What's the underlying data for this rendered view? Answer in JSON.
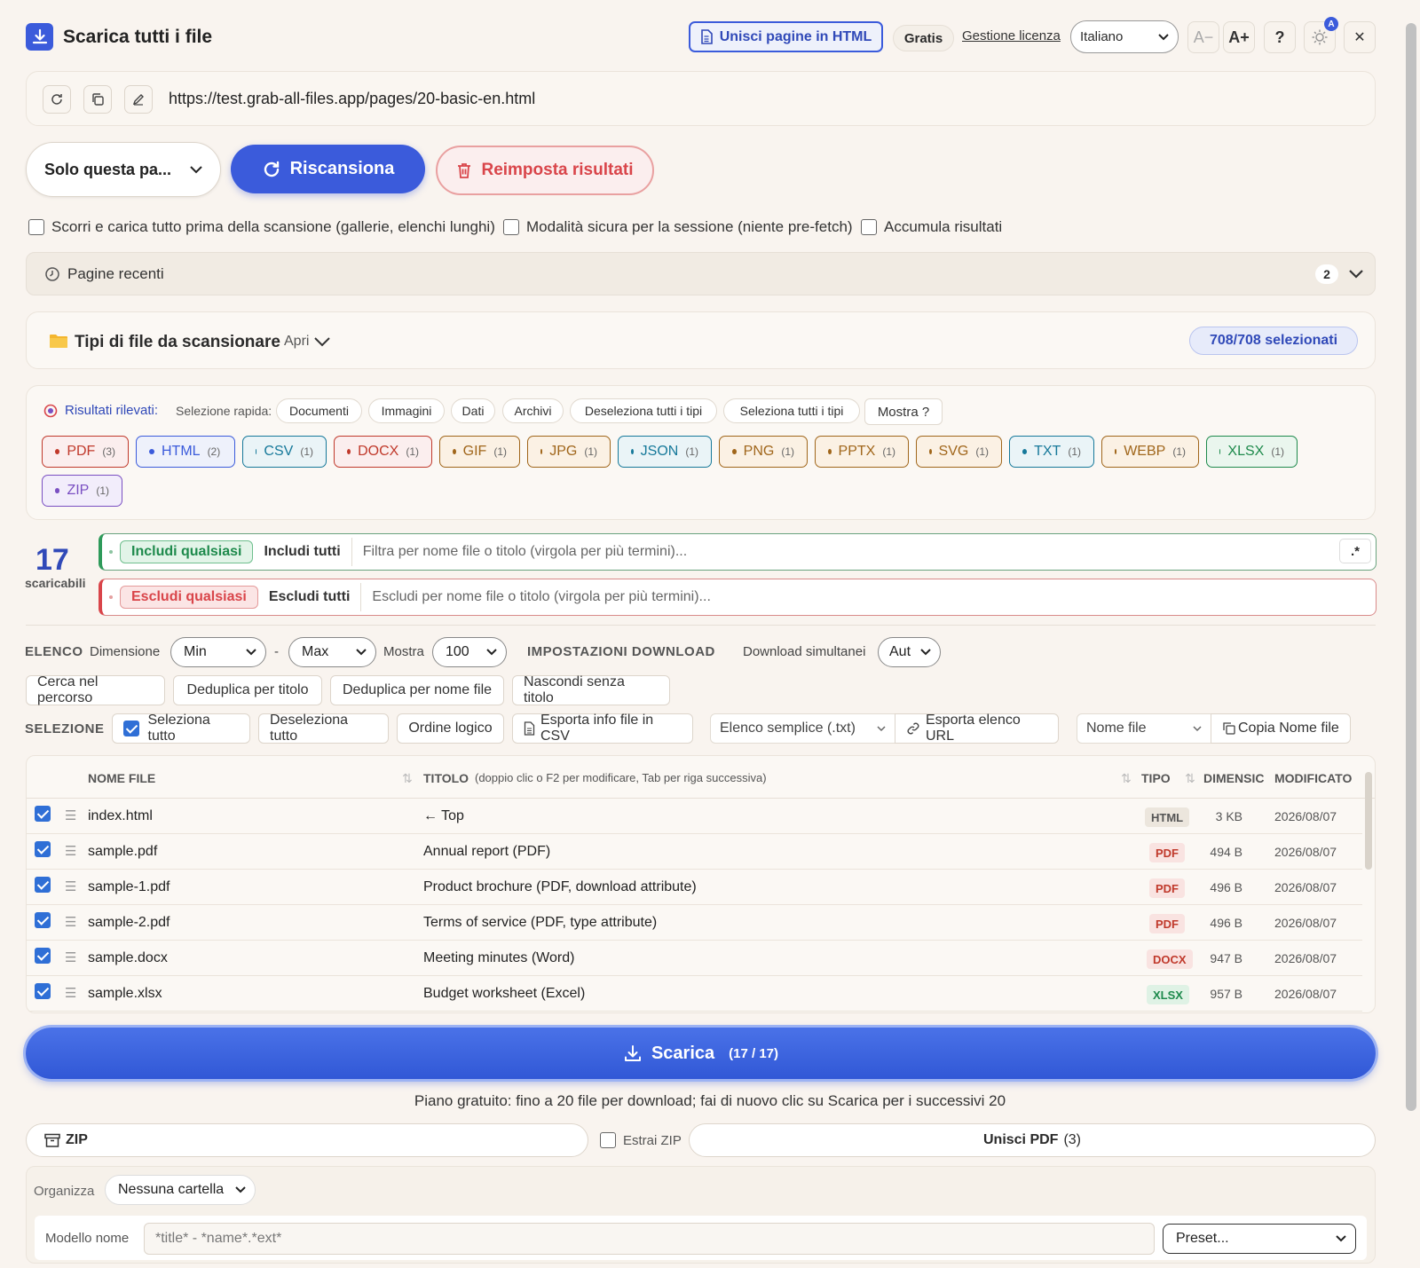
{
  "header": {
    "title": "Scarica tutti i file",
    "merge_html": "Unisci pagine in HTML",
    "plan": "Gratis",
    "license_link": "Gestione licenza",
    "language": "Italiano",
    "font_minus": "A−",
    "font_plus": "A+",
    "help": "?",
    "theme_badge": "A",
    "close": "✕"
  },
  "url": "https://test.grab-all-files.app/pages/20-basic-en.html",
  "scan": {
    "scope": "Solo questa pa...",
    "rescan": "Riscansiona",
    "reset": "Reimposta risultati"
  },
  "options": [
    {
      "label": "Scorri e carica tutto prima della scansione (gallerie, elenchi lunghi)",
      "checked": false
    },
    {
      "label": "Modalità sicura per la sessione (niente pre-fetch)",
      "checked": false
    },
    {
      "label": "Accumula risultati",
      "checked": false
    }
  ],
  "recent": {
    "label": "Pagine recenti",
    "count": "2"
  },
  "file_types": {
    "label": "Tipi di file da scansionare",
    "toggle": "Apri",
    "selected": "708/708 selezionati"
  },
  "results": {
    "label": "Risultati rilevati:",
    "quick_label": "Selezione rapida:",
    "quick": [
      "Documenti",
      "Immagini",
      "Dati",
      "Archivi",
      "Deseleziona tutti i tipi",
      "Seleziona tutti i tipi",
      "Mostra ?"
    ],
    "chips": [
      {
        "name": "PDF",
        "count": "(3)",
        "color": "#c0392b",
        "bg": "#fbeeee"
      },
      {
        "name": "HTML",
        "count": "(2)",
        "color": "#3b5bdb",
        "bg": "#eef1fb"
      },
      {
        "name": "CSV",
        "count": "(1)",
        "color": "#16799a",
        "bg": "#eaf4f7"
      },
      {
        "name": "DOCX",
        "count": "(1)",
        "color": "#c0392b",
        "bg": "#fbeeee"
      },
      {
        "name": "GIF",
        "count": "(1)",
        "color": "#a0661b",
        "bg": "#fbf1e4"
      },
      {
        "name": "JPG",
        "count": "(1)",
        "color": "#a0661b",
        "bg": "#fbf1e4"
      },
      {
        "name": "JSON",
        "count": "(1)",
        "color": "#16799a",
        "bg": "#eaf4f7"
      },
      {
        "name": "PNG",
        "count": "(1)",
        "color": "#a0661b",
        "bg": "#fbf1e4"
      },
      {
        "name": "PPTX",
        "count": "(1)",
        "color": "#a0661b",
        "bg": "#fbf1e4"
      },
      {
        "name": "SVG",
        "count": "(1)",
        "color": "#a0661b",
        "bg": "#fbf1e4"
      },
      {
        "name": "TXT",
        "count": "(1)",
        "color": "#16799a",
        "bg": "#eaf4f7"
      },
      {
        "name": "WEBP",
        "count": "(1)",
        "color": "#a0661b",
        "bg": "#fbf1e4"
      },
      {
        "name": "XLSX",
        "count": "(1)",
        "color": "#1e8a4c",
        "bg": "#eaf6ee"
      },
      {
        "name": "ZIP",
        "count": "(1)",
        "color": "#7a4fc2",
        "bg": "#f2edfb"
      }
    ]
  },
  "count": {
    "value": "17",
    "label": "scaricabili"
  },
  "include": {
    "active": "Includi qualsiasi",
    "other": "Includi tutti",
    "placeholder": "Filtra per nome file o titolo (virgola per più termini)...",
    "regex": ".*"
  },
  "exclude": {
    "active": "Escludi qualsiasi",
    "other": "Escludi tutti",
    "placeholder": "Escludi per nome file o titolo (virgola per più termini)..."
  },
  "list": {
    "title": "ELENCO",
    "size_label": "Dimensione",
    "min": "Min",
    "dash": "-",
    "max": "Max",
    "show_label": "Mostra",
    "show_value": "100",
    "dl_title": "IMPOSTAZIONI DOWNLOAD",
    "concurrent_label": "Download simultanei",
    "concurrent_value": "Aut",
    "buttons": [
      "Cerca nel percorso",
      "Deduplica per titolo",
      "Deduplica per nome file",
      "Nascondi senza titolo"
    ]
  },
  "selection": {
    "title": "SELEZIONE",
    "select_all": "Seleziona tutto",
    "deselect_all": "Deseleziona tutto",
    "logical_order": "Ordine logico",
    "export_csv": "Esporta info file in CSV",
    "list_format": "Elenco semplice (.txt)",
    "export_urls": "Esporta elenco URL",
    "copy_field": "Nome file",
    "copy_btn": "Copia Nome file"
  },
  "table": {
    "headers": {
      "name": "NOME FILE",
      "title": "TITOLO",
      "title_hint": "(doppio clic o F2 per modificare, Tab per riga successiva)",
      "type": "TIPO",
      "size": "DIMENSIC",
      "modified": "MODIFICATO"
    },
    "rows": [
      {
        "name": "index.html",
        "title": "← Top",
        "type": "HTML",
        "size": "3 KB",
        "date": "2026/08/07",
        "tc": "#555",
        "tb": "#ece6dd"
      },
      {
        "name": "sample.pdf",
        "title": "Annual report (PDF)",
        "type": "PDF",
        "size": "494 B",
        "date": "2026/08/07",
        "tc": "#c0392b",
        "tb": "#f9e3e1"
      },
      {
        "name": "sample-1.pdf",
        "title": "Product brochure (PDF, download attribute)",
        "type": "PDF",
        "size": "496 B",
        "date": "2026/08/07",
        "tc": "#c0392b",
        "tb": "#f9e3e1"
      },
      {
        "name": "sample-2.pdf",
        "title": "Terms of service (PDF, type attribute)",
        "type": "PDF",
        "size": "496 B",
        "date": "2026/08/07",
        "tc": "#c0392b",
        "tb": "#f9e3e1"
      },
      {
        "name": "sample.docx",
        "title": "Meeting minutes (Word)",
        "type": "DOCX",
        "size": "947 B",
        "date": "2026/08/07",
        "tc": "#c0392b",
        "tb": "#f9e3e1"
      },
      {
        "name": "sample.xlsx",
        "title": "Budget worksheet (Excel)",
        "type": "XLSX",
        "size": "957 B",
        "date": "2026/08/07",
        "tc": "#1e8a4c",
        "tb": "#dff2e5"
      }
    ]
  },
  "download": {
    "label": "Scarica",
    "count": "(17 / 17)"
  },
  "free_note": "Piano gratuito: fino a 20 file per download; fai di nuovo clic su Scarica per i successivi 20",
  "zip": {
    "label": "ZIP",
    "extract": "Estrai ZIP",
    "merge_pdf": "Unisci PDF",
    "merge_count": "(3)"
  },
  "organize": {
    "label": "Organizza",
    "value": "Nessuna cartella"
  },
  "naming": {
    "label": "Modello nome",
    "placeholder": "*title* - *name*.*ext*",
    "preset": "Preset..."
  }
}
